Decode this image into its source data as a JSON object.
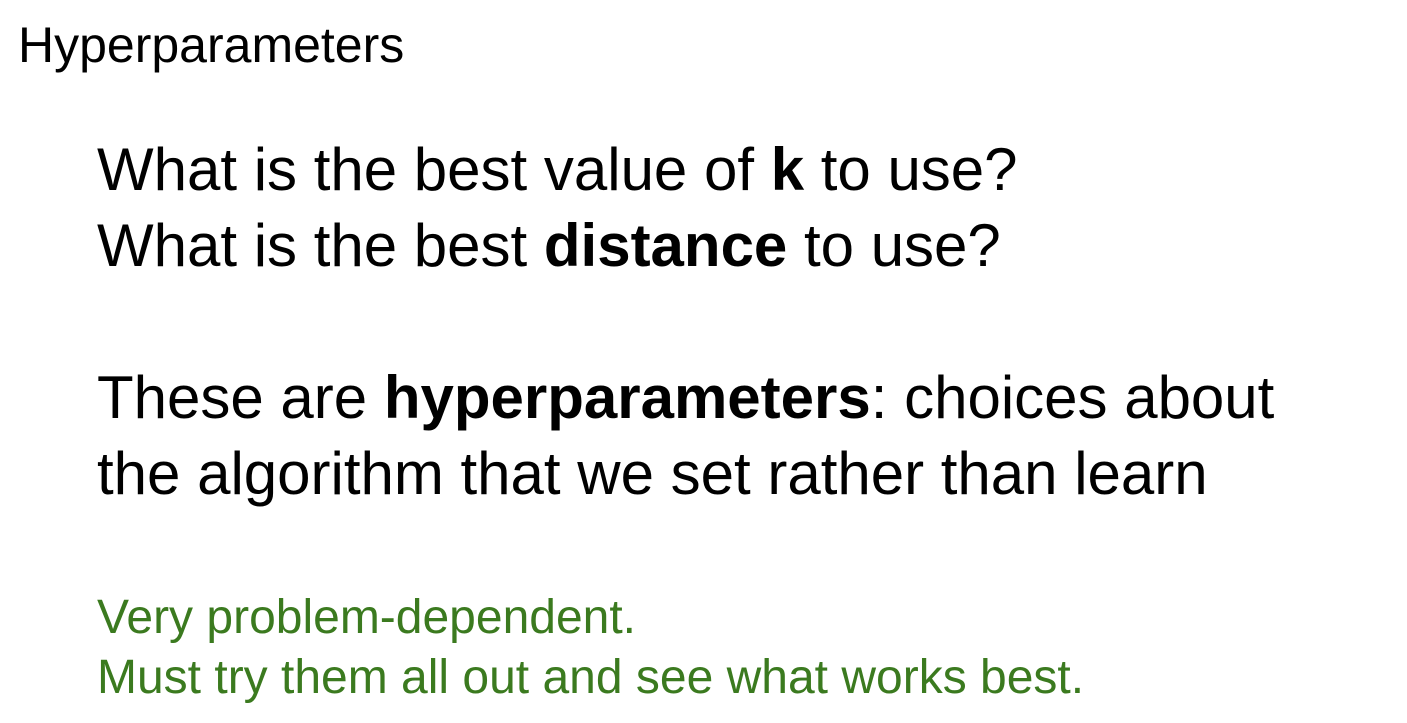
{
  "slide": {
    "title": "Hyperparameters",
    "questions": [
      {
        "before": "What is the best value of ",
        "bold": "k",
        "after": " to use?"
      },
      {
        "before": "What is the best ",
        "bold": "distance",
        "after": " to use?"
      }
    ],
    "definition": {
      "line1_before": "These are ",
      "line1_bold": "hyperparameters",
      "line1_after": ": choices about",
      "line2": "the algorithm that we set rather than learn"
    },
    "notes": [
      "Very problem-dependent.",
      "Must try them all out and see what works best."
    ],
    "colors": {
      "text": "#000000",
      "note_text": "#3b7a1f",
      "background": "#ffffff"
    }
  }
}
